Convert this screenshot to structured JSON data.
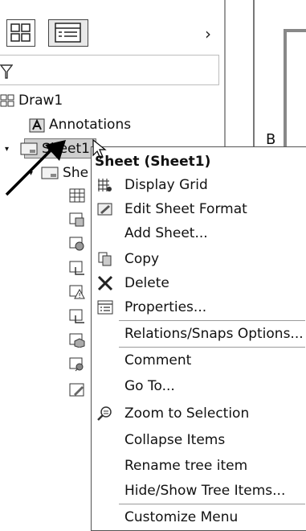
{
  "toolbar": {
    "chevron": "›"
  },
  "tree": {
    "root_label": "Draw1",
    "annotations_label": "Annotations",
    "sheet_label": "Sheet1",
    "subsheet_label": "She",
    "sub_icons": [
      "table-icon",
      "view-icon",
      "view-icon",
      "section-icon",
      "warning-view-icon",
      "section-icon",
      "model-icon",
      "detail-icon",
      "note-icon"
    ]
  },
  "drawing": {
    "zone_letter": "B"
  },
  "context_menu": {
    "title": "Sheet (Sheet1)",
    "items": [
      {
        "label": "Display Grid",
        "icon": "grid-icon"
      },
      {
        "label": "Edit Sheet Format",
        "icon": "edit-sheet-format-icon"
      },
      {
        "label": "Add Sheet...",
        "icon": ""
      },
      {
        "label": "Copy",
        "icon": "copy-icon"
      },
      {
        "label": "Delete",
        "icon": "delete-icon"
      },
      {
        "label": "Properties...",
        "icon": "properties-icon"
      },
      {
        "label": "Relations/Snaps Options...",
        "icon": ""
      },
      {
        "label": "Comment",
        "icon": ""
      },
      {
        "label": "Go To...",
        "icon": ""
      },
      {
        "label": "Zoom to Selection",
        "icon": "zoom-icon"
      },
      {
        "label": "Collapse Items",
        "icon": ""
      },
      {
        "label": "Rename tree item",
        "icon": ""
      },
      {
        "label": "Hide/Show Tree Items...",
        "icon": ""
      },
      {
        "label": "Customize Menu",
        "icon": ""
      }
    ]
  }
}
